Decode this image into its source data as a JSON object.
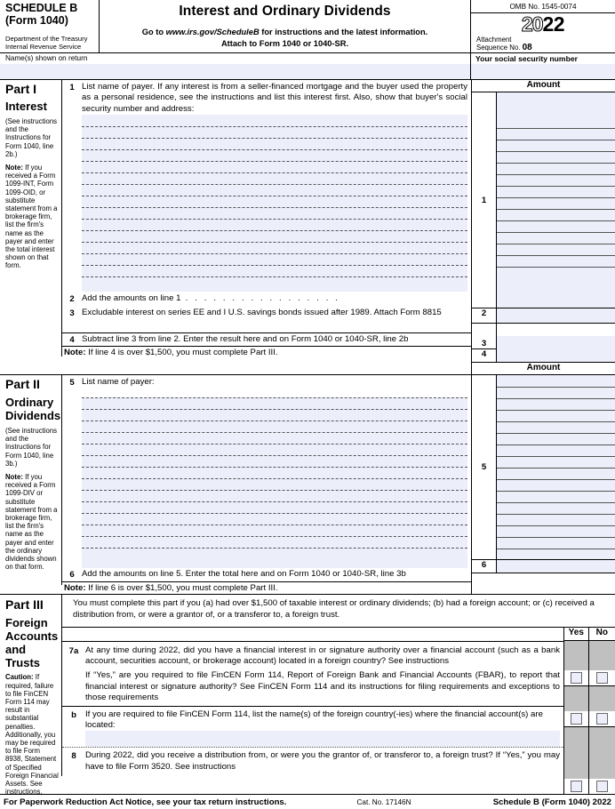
{
  "header": {
    "schedule": "SCHEDULE B",
    "form": "(Form 1040)",
    "department": "Department of the Treasury",
    "service": "Internal Revenue Service",
    "title": "Interest and Ordinary Dividends",
    "goto_prefix": "Go to ",
    "goto_url": "www.irs.gov/ScheduleB",
    "goto_suffix": " for instructions and the latest information.",
    "attach_to": "Attach to Form 1040 or 1040-SR.",
    "omb": "OMB No. 1545-0074",
    "year_hollow": "20",
    "year_solid": "22",
    "attachment_label1": "Attachment",
    "attachment_label2": "Sequence No.",
    "attachment_no": "08"
  },
  "name_row": {
    "name_label": "Name(s) shown on return",
    "name_value": "",
    "ssn_label": "Your social security number",
    "ssn_value": ""
  },
  "part1": {
    "part_title": "Part I",
    "part_name": "Interest",
    "side_note_1": "(See instructions and the Instructions for Form 1040, line 2b.)",
    "side_note_2_bold": "Note:",
    "side_note_2": " If you received a Form 1099-INT, Form 1099-OID, or substitute statement from a brokerage firm, list the firm's name as the payer and enter the total interest shown on that form.",
    "amount_header": "Amount",
    "line1_num": "1",
    "line1_text": "List name of payer. If any interest is from a seller-financed mortgage and the buyer used the property as a personal residence, see the instructions and list this interest first. Also, show that buyer's social security number and address:",
    "line1_amount_num": "1",
    "line1_amount_value": "",
    "line2_num": "2",
    "line2_text": "Add the amounts on line 1",
    "line2_amount_num": "2",
    "line2_amount_value": "",
    "line3_num": "3",
    "line3_text": "Excludable interest on series EE and I U.S. savings bonds issued after 1989. Attach Form 8815",
    "line3_amount_num": "3",
    "line3_amount_value": "",
    "line4_num": "4",
    "line4_text": "Subtract line 3 from line 2. Enter the result here and on Form 1040 or 1040-SR, line 2b",
    "line4_amount_num": "4",
    "line4_amount_value": "",
    "note_bold": "Note:",
    "note_text": " If line 4 is over $1,500, you must complete Part III."
  },
  "part2": {
    "part_title": "Part II",
    "part_name_1": "Ordinary",
    "part_name_2": "Dividends",
    "side_note_1": "(See instructions and the Instructions for Form 1040, line 3b.)",
    "side_note_2_bold": "Note:",
    "side_note_2": " If you received a Form 1099-DIV or substitute statement from a brokerage firm, list the firm's name as the payer and enter the ordinary dividends shown on that form.",
    "amount_header": "Amount",
    "line5_num": "5",
    "line5_text": "List name of payer:",
    "line5_amount_num": "5",
    "line5_amount_value": "",
    "line6_num": "6",
    "line6_text": "Add the amounts on line 5. Enter the total here and on Form 1040 or 1040-SR, line 3b",
    "line6_amount_num": "6",
    "line6_amount_value": "",
    "note_bold": "Note:",
    "note_text": " If line 6 is over  $1,500, you must complete Part III."
  },
  "part3": {
    "part_title": "Part III",
    "part_name_1": "Foreign",
    "part_name_2": "Accounts",
    "part_name_3": "and Trusts",
    "caution_bold": "Caution:",
    "caution_text": " If required, failure to file FinCEN Form 114 may result in substantial penalties. Additionally, you may be required to file Form 8938, Statement of Specified Foreign Financial Assets. See instructions.",
    "intro": "You must complete this part if you (a) had over $1,500 of taxable interest or ordinary dividends; (b) had a foreign account; or (c) received a distribution from, or were a grantor of, or a transferor to, a foreign trust.",
    "yes_header": "Yes",
    "no_header": "No",
    "line7a_num": "7a",
    "line7a_text": "At any time during 2022, did you have a financial interest in or signature authority over a financial account (such as a bank account, securities account, or brokerage account) located in a foreign country? See instructions",
    "line7a2_text": "If “Yes,” are you required to file FinCEN Form 114, Report of Foreign Bank and Financial Accounts (FBAR), to report that financial interest or signature authority? See FinCEN Form 114 and its instructions for filing requirements and exceptions to those requirements",
    "line7b_num": "b",
    "line7b_text": "If you are required to file FinCEN Form 114, list the name(s) of the foreign country(-ies) where the financial account(s) are located:",
    "line7b_value": "",
    "line8_num": "8",
    "line8_text": "During 2022, did you receive a distribution from, or were you the grantor of, or transferor to, a foreign trust? If “Yes,” you may have to file Form 3520. See instructions"
  },
  "footer": {
    "paperwork": "For Paperwork Reduction Act Notice, see your tax return instructions.",
    "cat_no": "Cat. No. 17146N",
    "schedule_ref": "Schedule B (Form 1040) 2022"
  },
  "colors": {
    "field_shade": "#eceefa",
    "gray_shade": "#c0c0c0",
    "rule": "#000000"
  }
}
